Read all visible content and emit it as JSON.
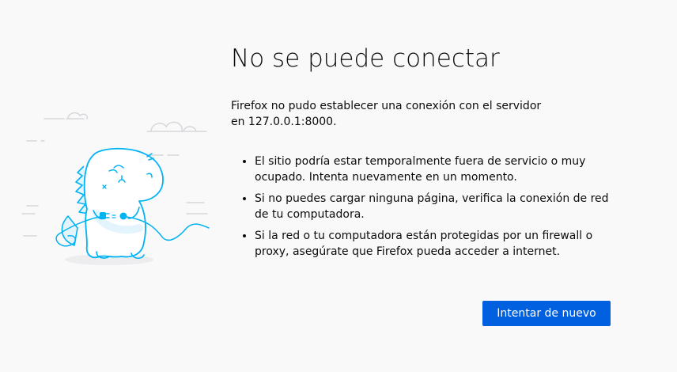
{
  "error": {
    "title": "No se puede conectar",
    "description": "Firefox no pudo establecer una conexión con el servidor en 127.0.0.1:8000.",
    "reasons": [
      "El sitio podría estar temporalmente fuera de servicio o muy ocupado. Intenta nuevamente en un momento.",
      "Si no puedes cargar ninguna página, verifica la conexión de red de tu computadora.",
      "Si la red o tu computadora están protegidas por un firewall o proxy, asegúrate que Firefox pueda acceder a internet."
    ],
    "retry_label": "Intentar de nuevo"
  },
  "illustration": {
    "icon": "disconnected-dino-illustration",
    "accent_color": "#00b3f4",
    "light_color": "#e3f4fd"
  }
}
